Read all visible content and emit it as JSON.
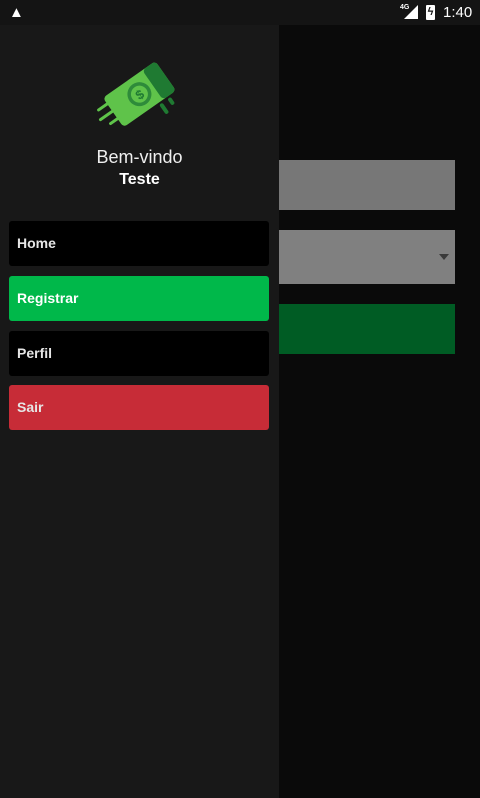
{
  "status_bar": {
    "warning_icon": "warning-icon",
    "network": "4G",
    "battery_icon": "battery-charging-icon",
    "time": "1:40"
  },
  "drawer": {
    "logo_icon": "money-flying-icon",
    "welcome": "Bem-vindo",
    "username": "Teste",
    "items": [
      {
        "label": "Home",
        "color": "#000000"
      },
      {
        "label": "Registrar",
        "color": "#00b84a"
      },
      {
        "label": "Perfil",
        "color": "#000000"
      },
      {
        "label": "Sair",
        "color": "#c72c37"
      }
    ]
  }
}
